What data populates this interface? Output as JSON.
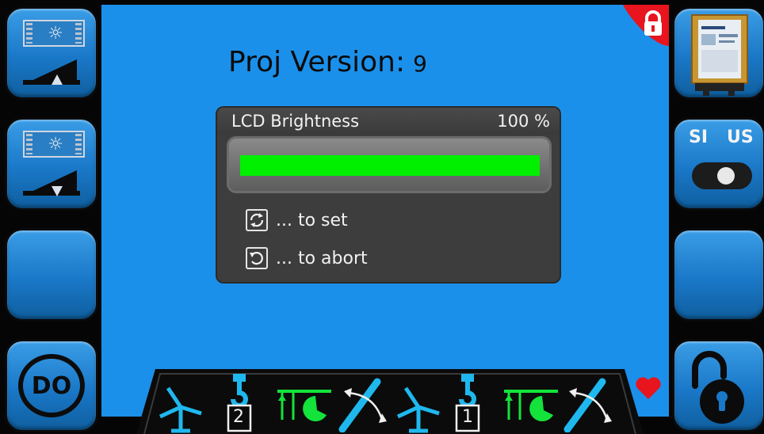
{
  "project": {
    "label": "Proj Version:",
    "version": "9"
  },
  "dialog": {
    "title": "LCD Brightness",
    "value_text": "100 %",
    "progress_fraction": 1.0,
    "set_action": "... to set",
    "abort_action": "... to abort",
    "colors": {
      "bar_fill": "#00f000",
      "background": "#3d3d3d"
    }
  },
  "left_buttons": [
    {
      "icon": "brightness-up-icon"
    },
    {
      "icon": "brightness-down-icon"
    },
    {
      "icon": ""
    },
    {
      "label": "DO",
      "icon": "do-icon"
    }
  ],
  "right_buttons": [
    {
      "icon": "controller-device-icon"
    },
    {
      "si": "SI",
      "us": "US",
      "icon": "units-toggle-icon"
    },
    {
      "icon": ""
    },
    {
      "icon": "unlock-icon"
    }
  ],
  "status_bar": {
    "icons": [
      "wind-turbine-icon",
      "hook-icon",
      "trolley-icon",
      "boom-angle-icon",
      "wind-turbine-icon",
      "hook-icon",
      "trolley-icon",
      "boom-angle-icon"
    ],
    "hook_numbers": [
      "2",
      "1"
    ]
  },
  "colors": {
    "screen_bg": "#1b90ea",
    "button_bg": "#1a78c8",
    "accent_green": "#00f000",
    "alert_red": "#e8141e"
  }
}
